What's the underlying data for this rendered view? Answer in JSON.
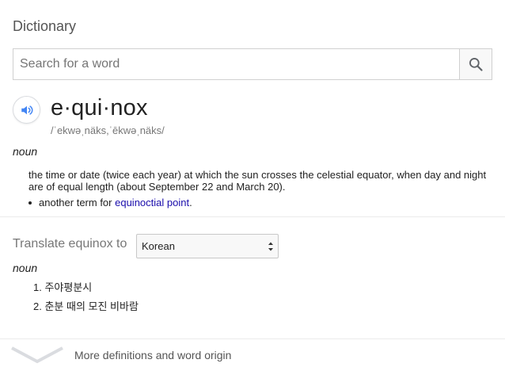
{
  "header": {
    "title": "Dictionary"
  },
  "search": {
    "placeholder": "Search for a word",
    "value": ""
  },
  "entry": {
    "word": "e·qui·nox",
    "phonetic": "/ˈekwəˌnäks,ˈēkwəˌnäks/",
    "part_of_speech": "noun",
    "definition": "the time or date (twice each year) at which the sun crosses the celestial equator, when day and night are of equal length (about September 22 and March 20).",
    "sub_prefix": "another term for ",
    "sub_link": "equinoctial point",
    "sub_suffix": "."
  },
  "translate": {
    "label": "Translate equinox to",
    "selected_language": "Korean",
    "part_of_speech": "noun",
    "items": [
      "1. 주야평분시",
      "2. 춘분 때의 모진 비바람"
    ]
  },
  "footer": {
    "more_label": "More definitions and word origin"
  },
  "colors": {
    "link": "#1a0dab",
    "speaker_blue": "#4285f4",
    "muted": "#777777"
  },
  "icons": {
    "search": "search-icon",
    "speaker": "speaker-icon",
    "chevron": "chevron-down-icon",
    "select_arrows": "select-arrows-icon"
  }
}
